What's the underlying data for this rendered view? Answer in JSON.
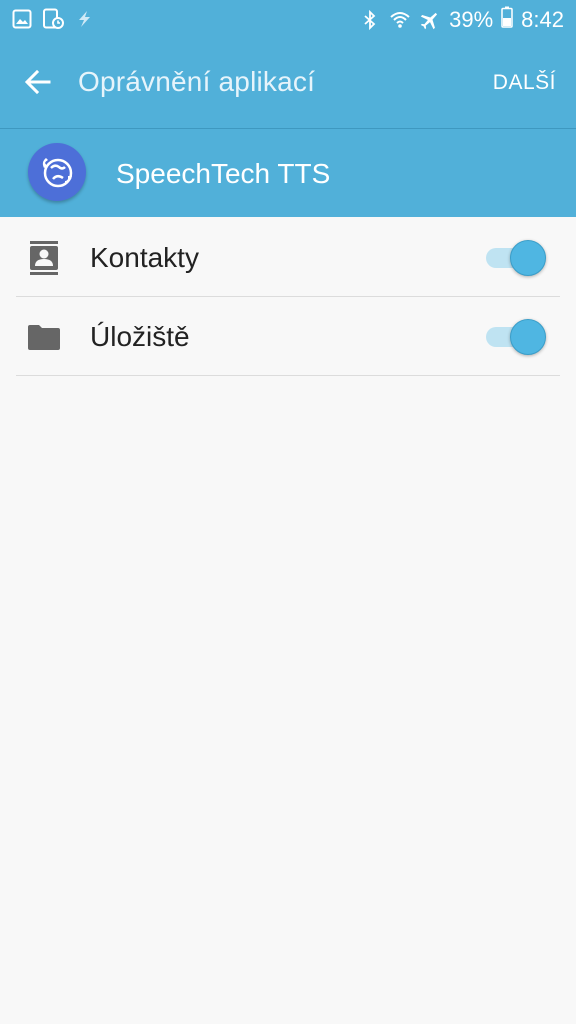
{
  "status_bar": {
    "battery_percent": "39%",
    "time": "8:42",
    "left_icons": [
      "gallery-icon",
      "screenshot-icon",
      "charging-bolt-icon"
    ],
    "right_icons": [
      "bluetooth-icon",
      "wifi-icon",
      "airplane-icon",
      "battery-icon"
    ]
  },
  "app_bar": {
    "title": "Oprávnění aplikací",
    "next_label": "DALŠÍ"
  },
  "app_header": {
    "app_name": "SpeechTech TTS"
  },
  "permissions": [
    {
      "label": "Kontakty",
      "icon": "contacts-icon",
      "enabled": true
    },
    {
      "label": "Úložiště",
      "icon": "folder-icon",
      "enabled": true
    }
  ],
  "colors": {
    "accent": "#51b0d9",
    "toggle_on": "#4fb6e2",
    "app_icon_bg": "#4d6fd8"
  }
}
